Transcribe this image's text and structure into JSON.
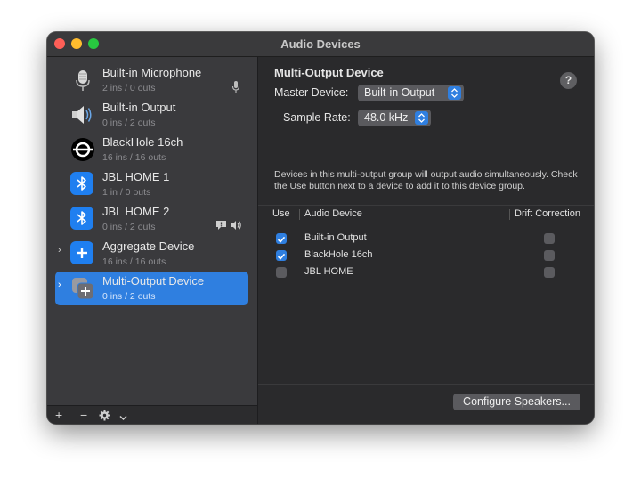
{
  "window": {
    "title": "Audio Devices"
  },
  "sidebar": {
    "devices": [
      {
        "name": "Built-in Microphone",
        "io": "2 ins / 0 outs",
        "icon": "microphone-icon"
      },
      {
        "name": "Built-in Output",
        "io": "0 ins / 2 outs",
        "icon": "speaker-icon"
      },
      {
        "name": "BlackHole 16ch",
        "io": "16 ins / 16 outs",
        "icon": "blackhole-icon"
      },
      {
        "name": "JBL HOME 1",
        "io": "1 in / 0 outs",
        "icon": "bluetooth-icon"
      },
      {
        "name": "JBL HOME 2",
        "io": "0 ins / 2 outs",
        "icon": "bluetooth-icon"
      },
      {
        "name": "Aggregate Device",
        "io": "16 ins / 16 outs",
        "icon": "aggregate-icon"
      },
      {
        "name": "Multi-Output Device",
        "io": "0 ins / 2 outs",
        "icon": "multi-output-icon",
        "selected": true
      }
    ],
    "toolbar": {
      "add": "+",
      "remove": "−"
    }
  },
  "detail": {
    "heading": "Multi-Output Device",
    "master_device_label": "Master Device:",
    "master_device_value": "Built-in Output",
    "sample_rate_label": "Sample Rate:",
    "sample_rate_value": "48.0 kHz",
    "description": "Devices in this multi-output group will output audio simultaneously. Check the Use button next to a device to add it to this device group.",
    "columns": {
      "use": "Use",
      "device": "Audio Device",
      "drift": "Drift Correction"
    },
    "rows": [
      {
        "device": "Built-in Output",
        "use": true,
        "drift": false
      },
      {
        "device": "BlackHole 16ch",
        "use": true,
        "drift": false
      },
      {
        "device": "JBL HOME",
        "use": false,
        "drift": false
      }
    ],
    "configure_button": "Configure Speakers...",
    "help": "?"
  },
  "colors": {
    "accent": "#2f7fe0",
    "window_bg": "#2a2a2c",
    "sidebar_bg": "#3a3a3d"
  }
}
